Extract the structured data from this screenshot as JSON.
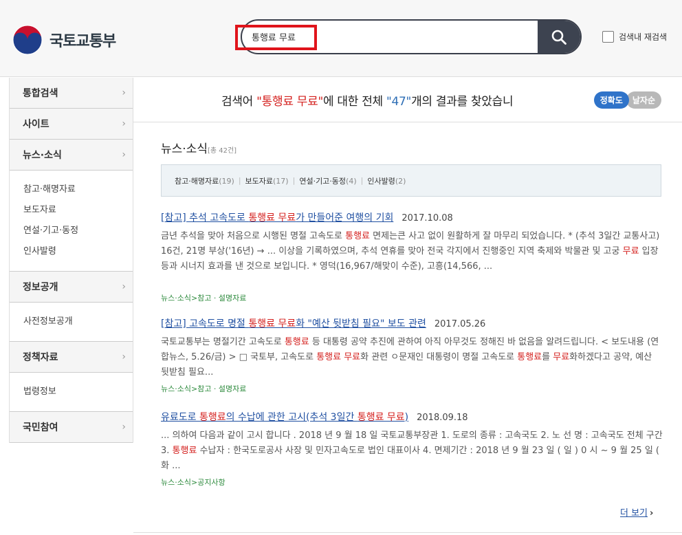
{
  "header": {
    "logo_text": "국토교통부",
    "search_value": "통행료 무료",
    "research_label": "검색내 재검색",
    "colors": {
      "logo_red": "#c8102e",
      "logo_blue": "#1f3e8a",
      "highlight_box": "#e0141b"
    }
  },
  "sidebar": {
    "menu": [
      {
        "label": "통합검색"
      },
      {
        "label": "사이트"
      },
      {
        "label": "뉴스·소식",
        "sub": [
          "참고·해명자료",
          "보도자료",
          "연설·기고·동정",
          "인사발령"
        ]
      },
      {
        "label": "정보공개",
        "sub": [
          "사전정보공개"
        ]
      },
      {
        "label": "정책자료",
        "sub": [
          "법령정보"
        ]
      },
      {
        "label": "국민참여"
      }
    ]
  },
  "summary": {
    "prefix": "검색어 ",
    "keyword": "\"통행료 무료\"",
    "middle": "에 대한 전체 ",
    "count": "\"47\"",
    "suffix": "개의 결과를 찾았습니",
    "sort_accuracy": "정확도",
    "sort_date": "날자순"
  },
  "section": {
    "title": "뉴스·소식",
    "count": "[총 42건]",
    "categories": [
      {
        "label": "참고·해명자료",
        "count": "(19)"
      },
      {
        "label": "보도자료",
        "count": "(17)"
      },
      {
        "label": "연설·기고·동정",
        "count": "(4)"
      },
      {
        "label": "인사발령",
        "count": "(2)"
      }
    ]
  },
  "results": [
    {
      "title_parts": [
        "[참고] 추석 고속도로 ",
        "통행료 무료",
        "가 만들어준 여행의 기회"
      ],
      "date": "2017.10.08",
      "body_parts": [
        "금년 추석을 맞아 처음으로 시행된 명절 고속도로 ",
        "통행료",
        " 면제는큰 사고 없이 원활하게 잘 마무리 되었습니다. * (추석 3일간 교통사고) 16건, 21명 부상('16년) → ... 이상을 기록하였으며, 추석 연휴를 맞아 전국 각지에서 진행중인 지역 축제와 박물관 및 고궁 ",
        "무료",
        " 입장 등과 시너지 효과를 낸 것으로 보입니다. * 영덕(16,967/해맞이 수준), 고흥(14,566, ..."
      ],
      "path": "뉴스·소식>참고 · 설명자료"
    },
    {
      "title_parts": [
        "[참고] 고속도로 명절 ",
        "통행료 무료",
        "화 \"예산 뒷받침 필요\" 보도 관련"
      ],
      "date": "2017.05.26",
      "body_parts": [
        "국토교통부는 명절기간 고속도로 ",
        "통행료",
        " 등 대통령 공약 추진에 관하여 아직 아무것도 정해진 바 없음을 알려드립니다. < 보도내용 (연합뉴스, 5.26/금) > □ 국토부, 고속도로 ",
        "통행료 무료",
        "화 관련 ㅇ문재인 대통령이 명절 고속도로 ",
        "통행료",
        "를 ",
        "무료",
        "화하겠다고 공약, 예산 뒷받침 필요..."
      ],
      "path": "뉴스·소식>참고 · 설명자료"
    },
    {
      "title_parts": [
        "유료도로 ",
        "통행료",
        "의 수납에 관한 고시(추석 3일간 ",
        "통행료 무료",
        ")"
      ],
      "date": "2018.09.18",
      "body_parts": [
        "... 의하여 다음과 같이 고시 합니다 . 2018 년 9 월 18 일 국토교통부장관 1. 도로의 종류 : 고속국도 2. 노 선 명 : 고속국도 전체 구간 3. ",
        "통행료",
        " 수납자 : 한국도로공사 사장 및 민자고속도로 법인 대표이사 4. 면제기간 : 2018 년 9 월 23 일 ( 일 ) 0 시 ~ 9 월 25 일 ( 화 ..."
      ],
      "path": "뉴스·소식>공지사항"
    }
  ],
  "more_label": "더 보기"
}
